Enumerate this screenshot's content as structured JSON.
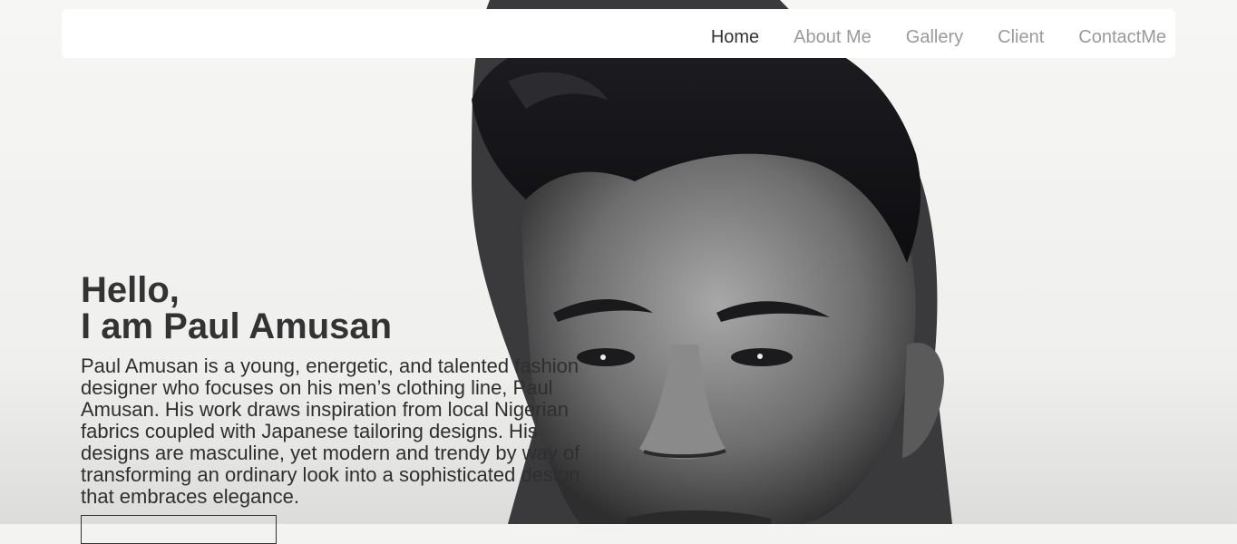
{
  "nav": {
    "items": [
      {
        "label": "Home",
        "active": true
      },
      {
        "label": "About Me",
        "active": false
      },
      {
        "label": "Gallery",
        "active": false
      },
      {
        "label": "Client",
        "active": false
      },
      {
        "label": "ContactMe",
        "active": false
      }
    ]
  },
  "hero": {
    "greeting_line1": "Hello,",
    "greeting_line2": "I am Paul Amusan",
    "bio": "Paul Amusan is a young, energetic, and talented fashion designer who focuses on his men’s clothing line, Paul Amusan. His work draws inspiration from local Nigerian fabrics coupled with Japanese tailoring designs. His designs are masculine, yet modern and trendy by way of transforming an ordinary look into a sophisticated design that embraces elegance."
  }
}
